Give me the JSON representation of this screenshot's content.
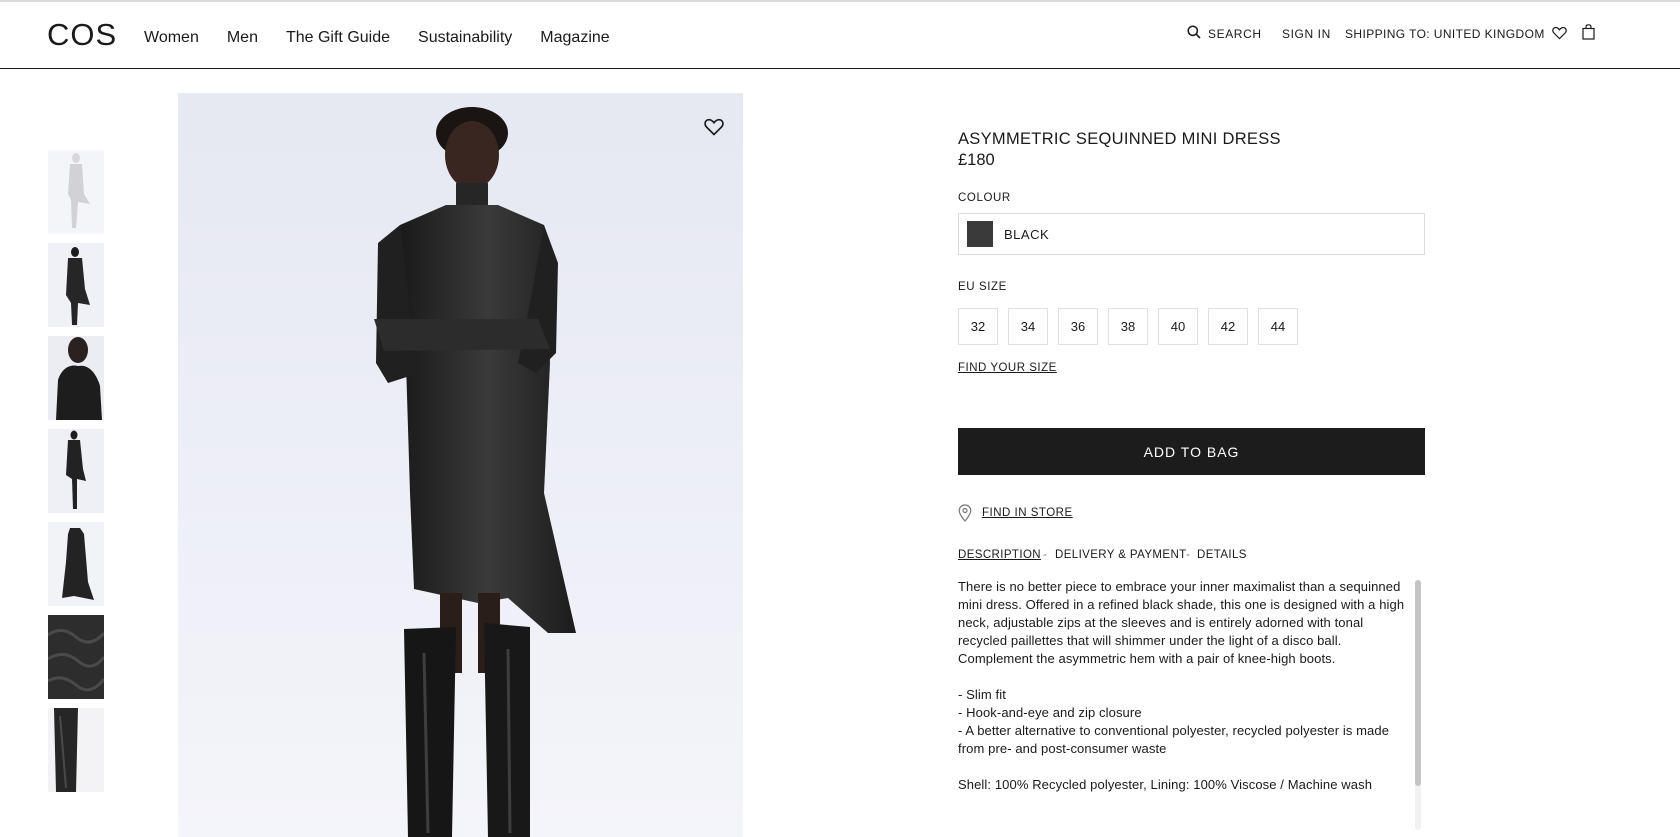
{
  "header": {
    "logo": "COS",
    "nav": [
      "Women",
      "Men",
      "The Gift Guide",
      "Sustainability",
      "Magazine"
    ],
    "search_label": "SEARCH",
    "sign_in": "SIGN IN",
    "shipping": "SHIPPING TO: UNITED KINGDOM"
  },
  "gallery": {
    "thumbnail_count": 7
  },
  "product": {
    "title": "ASYMMETRIC SEQUINNED MINI DRESS",
    "price": "£180",
    "colour_label": "COLOUR",
    "colour_value": "BLACK",
    "size_label": "EU SIZE",
    "sizes": [
      "32",
      "34",
      "36",
      "38",
      "40",
      "42",
      "44"
    ],
    "find_size": "FIND YOUR SIZE",
    "add_to_bag": "ADD TO BAG",
    "find_in_store": "FIND IN STORE"
  },
  "tabs": {
    "description": "DESCRIPTION",
    "delivery": "DELIVERY & PAYMENT",
    "details": "DETAILS",
    "separator": "-"
  },
  "description": {
    "intro": "There is no better piece to embrace your inner maximalist than a sequinned mini dress. Offered in a refined black shade, this one is designed with a high neck, adjustable zips at the sleeves and is entirely adorned with tonal recycled paillettes that will shimmer under the light of a disco ball. Complement the asymmetric hem with a pair of knee-high boots.",
    "bullets": [
      "- Slim fit",
      "- Hook-and-eye and zip closure",
      "- A better alternative to conventional polyester, recycled polyester is made from pre- and post-consumer waste"
    ],
    "composition": "Shell: 100% Recycled polyester, Lining: 100% Viscose / Machine wash"
  }
}
